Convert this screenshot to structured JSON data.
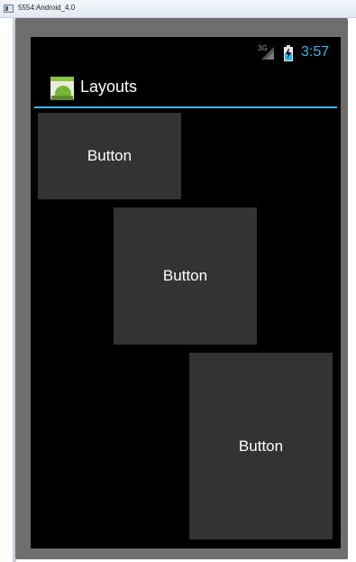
{
  "window": {
    "title": "5554:Android_4.0"
  },
  "statusbar": {
    "network_type": "3G",
    "time": "3:57",
    "icons": [
      "signal-icon",
      "battery-icon"
    ]
  },
  "actionbar": {
    "title": "Layouts",
    "icon": "app-icon"
  },
  "buttons": [
    {
      "label": "Button"
    },
    {
      "label": "Button"
    },
    {
      "label": "Button"
    }
  ],
  "colors": {
    "accent": "#33b5e5",
    "button_bg": "#333333",
    "screen_bg": "#000000",
    "bezel": "#6e6e6e"
  }
}
